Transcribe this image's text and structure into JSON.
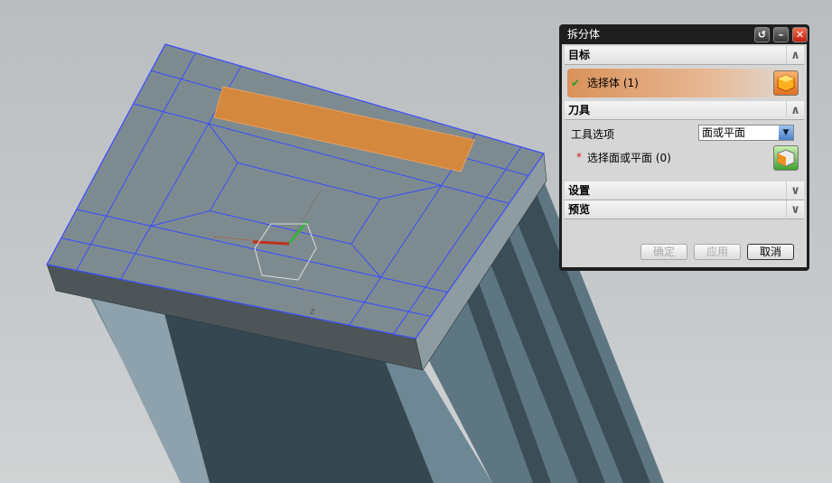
{
  "dialog": {
    "title": "拆分体",
    "sections": {
      "target": {
        "label": "目标",
        "expanded": true,
        "select_body": "选择体 (1)",
        "status": "complete"
      },
      "tool": {
        "label": "刀具",
        "expanded": true,
        "tool_option_label": "工具选项",
        "tool_option_value": "面或平面",
        "select_face": "选择面或平面 (0)",
        "required_marker": "*"
      },
      "settings": {
        "label": "设置",
        "expanded": false
      },
      "preview": {
        "label": "预览",
        "expanded": false
      }
    },
    "buttons": {
      "ok": "确定",
      "apply": "应用",
      "cancel": "取消"
    },
    "ok_enabled": false,
    "apply_enabled": false
  },
  "axis_labels": {
    "z": "Z"
  },
  "colors": {
    "edge": "#3a4cff",
    "highlight_face": "#d4883e",
    "face": "#7b8a90"
  }
}
